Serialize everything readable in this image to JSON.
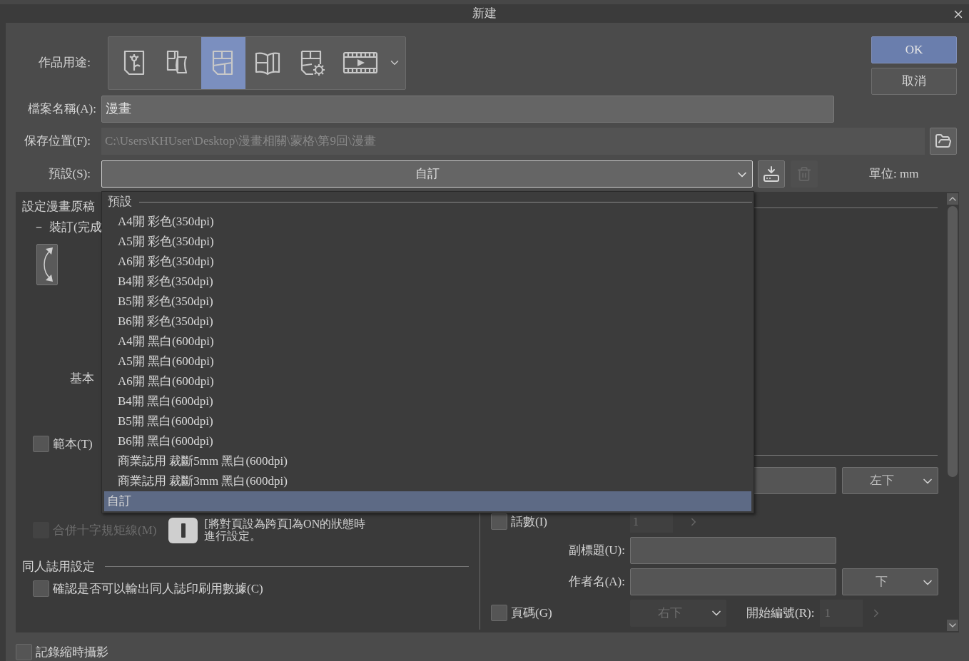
{
  "window": {
    "title": "新建"
  },
  "usage": {
    "label": "作品用途:",
    "options": [
      {
        "kind": "flower",
        "selected": false
      },
      {
        "kind": "scroll",
        "selected": false
      },
      {
        "kind": "panels",
        "selected": true
      },
      {
        "kind": "book",
        "selected": false
      },
      {
        "kind": "panels-gear",
        "selected": false
      },
      {
        "kind": "film",
        "selected": false
      }
    ]
  },
  "buttons": [
    {
      "label": "OK",
      "kind": "primary"
    },
    {
      "label": "取消",
      "kind": "normal"
    }
  ],
  "file_name": {
    "label": "檔案名稱(A):",
    "value": "漫畫"
  },
  "save_location": {
    "label": "保存位置(F):",
    "value": "C:\\Users\\KHUser\\Desktop\\漫畫相關\\蒙格\\第9回\\漫畫",
    "disabled": true
  },
  "preset": {
    "label": "預設(S):",
    "value": "自訂",
    "expanded": true,
    "unit": "單位: mm"
  },
  "dropdown": {
    "group": "預設",
    "items": [
      {
        "label": "A4開 彩色(350dpi)",
        "selected": false
      },
      {
        "label": "A5開 彩色(350dpi)",
        "selected": false
      },
      {
        "label": "A6開 彩色(350dpi)",
        "selected": false
      },
      {
        "label": "B4開 彩色(350dpi)",
        "selected": false
      },
      {
        "label": "B5開 彩色(350dpi)",
        "selected": false
      },
      {
        "label": "B6開 彩色(350dpi)",
        "selected": false
      },
      {
        "label": "A4開 黑白(600dpi)",
        "selected": false
      },
      {
        "label": "A5開 黑白(600dpi)",
        "selected": false
      },
      {
        "label": "A6開 黑白(600dpi)",
        "selected": false
      },
      {
        "label": "B4開 黑白(600dpi)",
        "selected": false
      },
      {
        "label": "B5開 黑白(600dpi)",
        "selected": false
      },
      {
        "label": "B6開 黑白(600dpi)",
        "selected": false
      },
      {
        "label": "商業誌用 裁斷5mm 黑白(600dpi)",
        "selected": false
      },
      {
        "label": "商業誌用 裁斷3mm 黑白(600dpi)",
        "selected": false
      },
      {
        "label": "自訂",
        "selected": true
      }
    ]
  },
  "left": {
    "section_title": "設定漫畫原稿",
    "binding": {
      "mark": "－",
      "label": "裝訂(完成"
    },
    "basic_label": "基本",
    "template": {
      "label": "範本(T)",
      "checked": false
    },
    "crop_marks": {
      "label": "合併十字規矩線(M)",
      "checked": false,
      "disabled": true
    },
    "note": [
      "[將對頁設為跨頁]為ON的狀態時",
      "進行設定。"
    ],
    "doujin": {
      "title": "同人誌用設定",
      "label": "確認是否可以輸出同人誌印刷用數據(C)",
      "checked": false
    }
  },
  "right": {
    "title_position": "左下",
    "episode": {
      "label": "話數(I)",
      "checked": false,
      "value": "1",
      "disabled": true
    },
    "subtitle": {
      "label": "副標題(U):"
    },
    "author": {
      "label": "作者名(A):",
      "position": "下"
    },
    "page_number": {
      "label": "頁碼(G)",
      "checked": false,
      "position": "右下",
      "disabled": true
    },
    "start_number": {
      "label": "開始編號(R):",
      "value": "1",
      "disabled": true
    }
  },
  "timelapse": {
    "label": "記錄縮時攝影",
    "checked": false
  }
}
